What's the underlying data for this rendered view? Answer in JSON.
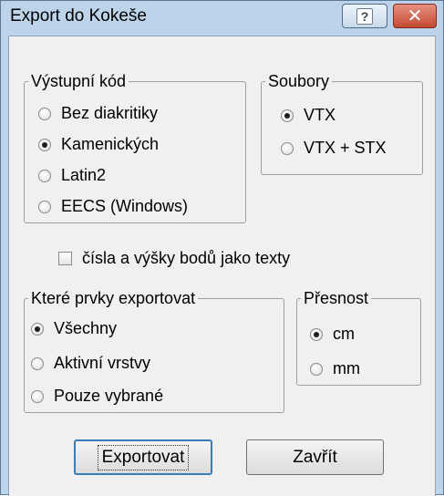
{
  "window": {
    "title": "Export do Kokeše",
    "help_glyph": "?",
    "close_glyph": "✕"
  },
  "vystupni_kod": {
    "legend": "Výstupní kód",
    "options": [
      {
        "label": "Bez diakritiky",
        "checked": false
      },
      {
        "label": "Kamenických",
        "checked": true
      },
      {
        "label": "Latin2",
        "checked": false
      },
      {
        "label": "EECS (Windows)",
        "checked": false
      }
    ]
  },
  "soubory": {
    "legend": "Soubory",
    "options": [
      {
        "label": "VTX",
        "checked": true
      },
      {
        "label": "VTX + STX",
        "checked": false
      }
    ]
  },
  "checkbox": {
    "label": "čísla a výšky bodů jako texty",
    "checked": false
  },
  "prvky": {
    "legend": "Které prvky exportovat",
    "options": [
      {
        "label": "Všechny",
        "checked": true
      },
      {
        "label": "Aktivní vrstvy",
        "checked": false
      },
      {
        "label": "Pouze vybrané",
        "checked": false
      }
    ]
  },
  "presnost": {
    "legend": "Přesnost",
    "options": [
      {
        "label": "cm",
        "checked": true
      },
      {
        "label": "mm",
        "checked": false
      }
    ]
  },
  "buttons": {
    "export_label": "Exportovat",
    "close_label": "Zavřít"
  }
}
